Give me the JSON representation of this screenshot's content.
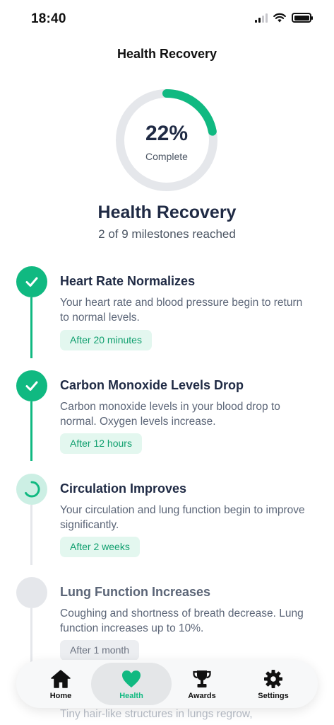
{
  "status_bar": {
    "time": "18:40"
  },
  "nav": {
    "title": "Health Recovery"
  },
  "progress": {
    "value_label": "22%",
    "caption": "Complete",
    "fraction": 0.22
  },
  "header": {
    "title": "Health Recovery",
    "subtitle": "2 of 9 milestones reached"
  },
  "milestones": [
    {
      "title": "Heart Rate Normalizes",
      "description": "Your heart rate and blood pressure begin to return to normal levels.",
      "badge": "After 20 minutes",
      "state": "done"
    },
    {
      "title": "Carbon Monoxide Levels Drop",
      "description": "Carbon monoxide levels in your blood drop to normal. Oxygen levels increase.",
      "badge": "After 12 hours",
      "state": "done"
    },
    {
      "title": "Circulation Improves",
      "description": "Your circulation and lung function begin to improve significantly.",
      "badge": "After 2 weeks",
      "state": "in-progress"
    },
    {
      "title": "Lung Function Increases",
      "description": "Coughing and shortness of breath decrease. Lung function increases up to 10%.",
      "badge": "After 1 month",
      "state": "locked"
    }
  ],
  "partial_milestone": {
    "description": "Tiny hair-like structures in lungs regrow,"
  },
  "tab_bar": {
    "items": [
      {
        "label": "Home",
        "icon": "house-icon"
      },
      {
        "label": "Health",
        "icon": "heart-icon",
        "active": true
      },
      {
        "label": "Awards",
        "icon": "trophy-icon"
      },
      {
        "label": "Settings",
        "icon": "gear-icon"
      }
    ]
  },
  "colors": {
    "accent": "#10b981",
    "track": "#e5e7eb",
    "text_dark": "#1f2a44",
    "text_muted": "#5b6577"
  }
}
